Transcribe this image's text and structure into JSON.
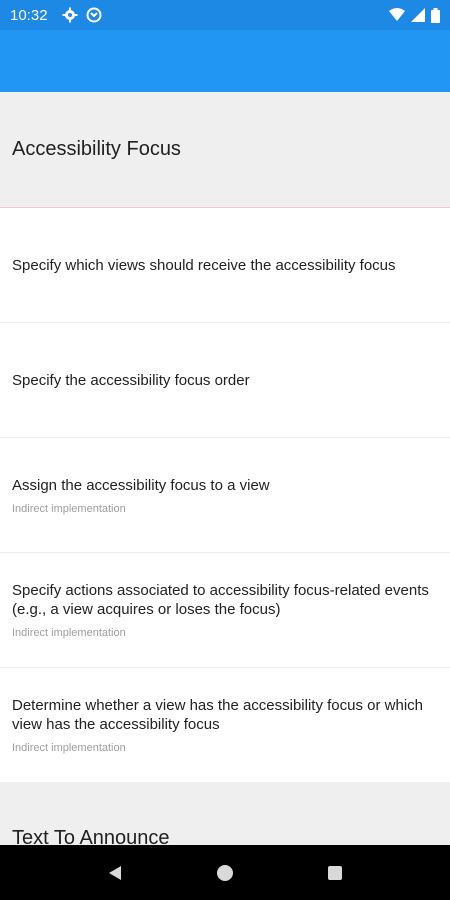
{
  "status_bar": {
    "time": "10:32",
    "left_icons": [
      "gear-icon",
      "sync-icon"
    ],
    "right_icons": [
      "wifi-icon",
      "signal-icon",
      "battery-icon"
    ]
  },
  "app_bar": {
    "color": "#2196f3"
  },
  "sections": [
    {
      "title": "Accessibility Focus",
      "items": [
        {
          "title": "Specify which views should receive the accessibility focus",
          "subtitle": ""
        },
        {
          "title": "Specify the accessibility focus order",
          "subtitle": ""
        },
        {
          "title": "Assign the accessibility focus to a view",
          "subtitle": "Indirect implementation"
        },
        {
          "title": "Specify actions associated to accessibility focus-related events (e.g., a view acquires or loses the focus)",
          "subtitle": "Indirect implementation"
        },
        {
          "title": "Determine whether a view has the accessibility focus or which view has the accessibility focus",
          "subtitle": "Indirect implementation"
        }
      ]
    },
    {
      "title": "Text To Announce"
    }
  ],
  "nav_bar": {
    "buttons": [
      "back-icon",
      "home-icon",
      "recents-icon"
    ]
  }
}
